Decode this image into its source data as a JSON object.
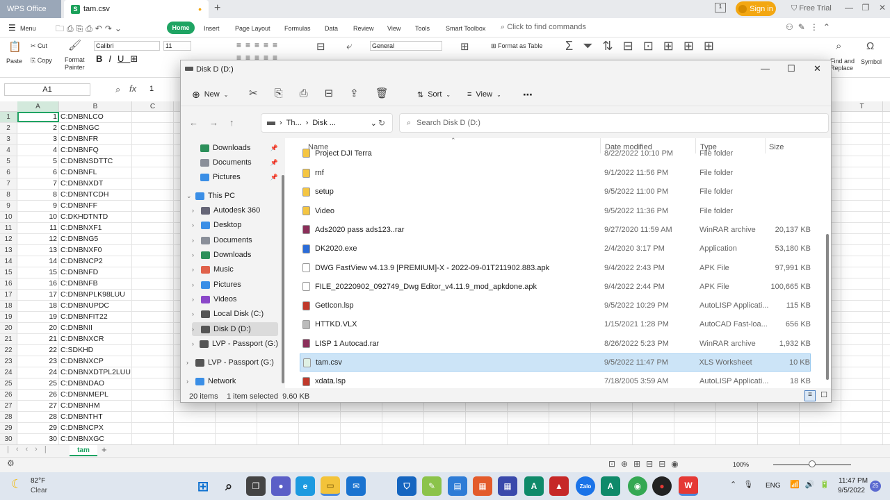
{
  "wps": {
    "tabs": [
      {
        "label": "WPS Office"
      },
      {
        "label": "tam.csv"
      }
    ],
    "csv_badge": "S",
    "sign_in": "Sign in",
    "free_trial": "Free Trial",
    "menu_label": "Menu",
    "ribbon_tabs": [
      "Home",
      "Insert",
      "Page Layout",
      "Formulas",
      "Data",
      "Review",
      "View",
      "Tools",
      "Smart Toolbox"
    ],
    "find_commands": "Click to find commands",
    "toolbar": {
      "paste": "Paste",
      "cut": "Cut",
      "copy": "Copy",
      "format_painter": "Format\nPainter",
      "font": "Calibri",
      "font_size": "11",
      "number_format": "General",
      "format_as_table": "Format as Table",
      "find_replace": "Find and\nReplace",
      "symbol": "Symbol"
    },
    "name_box": "A1",
    "formula_value": "1",
    "columns": [
      "A",
      "B",
      "C",
      "T"
    ],
    "rows": [
      {
        "n": "1",
        "a": "1",
        "b": "C:DNBNLCO"
      },
      {
        "n": "2",
        "a": "2",
        "b": "C:DNBNGC"
      },
      {
        "n": "3",
        "a": "3",
        "b": "C:DNBNFR"
      },
      {
        "n": "4",
        "a": "4",
        "b": "C:DNBNFQ"
      },
      {
        "n": "5",
        "a": "5",
        "b": "C:DNBNSDTTC"
      },
      {
        "n": "6",
        "a": "6",
        "b": "C:DNBNFL"
      },
      {
        "n": "7",
        "a": "7",
        "b": "C:DNBNXDT"
      },
      {
        "n": "8",
        "a": "8",
        "b": "C:DNBNTCDH"
      },
      {
        "n": "9",
        "a": "9",
        "b": "C:DNBNFF"
      },
      {
        "n": "10",
        "a": "10",
        "b": "C:DKHDTNTD"
      },
      {
        "n": "11",
        "a": "11",
        "b": "C:DNBNXF1"
      },
      {
        "n": "12",
        "a": "12",
        "b": "C:DNBNG5"
      },
      {
        "n": "13",
        "a": "13",
        "b": "C:DNBNXF0"
      },
      {
        "n": "14",
        "a": "14",
        "b": "C:DNBNCP2"
      },
      {
        "n": "15",
        "a": "15",
        "b": "C:DNBNFD"
      },
      {
        "n": "16",
        "a": "16",
        "b": "C:DNBNFB"
      },
      {
        "n": "17",
        "a": "17",
        "b": "C:DNBNPLK98LUU"
      },
      {
        "n": "18",
        "a": "18",
        "b": "C:DNBNUPDC"
      },
      {
        "n": "19",
        "a": "19",
        "b": "C:DNBNFIT22"
      },
      {
        "n": "20",
        "a": "20",
        "b": "C:DNBNII"
      },
      {
        "n": "21",
        "a": "21",
        "b": "C:DNBNXCR"
      },
      {
        "n": "22",
        "a": "22",
        "b": "C:SDKHD"
      },
      {
        "n": "23",
        "a": "23",
        "b": "C:DNBNXCP"
      },
      {
        "n": "24",
        "a": "24",
        "b": "C:DNBNXDTPL2LUU"
      },
      {
        "n": "25",
        "a": "25",
        "b": "C:DNBNDAO"
      },
      {
        "n": "26",
        "a": "26",
        "b": "C:DNBNMEPL"
      },
      {
        "n": "27",
        "a": "27",
        "b": "C:DNBNHM"
      },
      {
        "n": "28",
        "a": "28",
        "b": "C:DNBNTHT"
      },
      {
        "n": "29",
        "a": "29",
        "b": "C:DNBNCPX"
      },
      {
        "n": "30",
        "a": "30",
        "b": "C:DNBNXGC"
      }
    ],
    "sheet_tab": "tam",
    "zoom": "100%"
  },
  "explorer": {
    "title": "Disk D (D:)",
    "new_label": "New",
    "sort_label": "Sort",
    "view_label": "View",
    "address": [
      "Th...",
      "Disk ..."
    ],
    "search_placeholder": "Search Disk D (D:)",
    "nav": [
      {
        "label": "Downloads"
      },
      {
        "label": "Documents"
      },
      {
        "label": "Pictures"
      },
      {
        "label": "This PC"
      },
      {
        "label": "Autodesk 360"
      },
      {
        "label": "Desktop"
      },
      {
        "label": "Documents"
      },
      {
        "label": "Downloads"
      },
      {
        "label": "Music"
      },
      {
        "label": "Pictures"
      },
      {
        "label": "Videos"
      },
      {
        "label": "Local Disk (C:)"
      },
      {
        "label": "Disk D (D:)"
      },
      {
        "label": "LVP - Passport (G:)"
      },
      {
        "label": "LVP - Passport (G:)"
      },
      {
        "label": "Network"
      }
    ],
    "headers": {
      "name": "Name",
      "date": "Date modified",
      "type": "Type",
      "size": "Size"
    },
    "files": [
      {
        "name": "Project DJI Terra",
        "date": "8/22/2022 10:10 PM",
        "type": "File folder",
        "size": ""
      },
      {
        "name": "rnf",
        "date": "9/1/2022 11:56 PM",
        "type": "File folder",
        "size": ""
      },
      {
        "name": "setup",
        "date": "9/5/2022 11:00 PM",
        "type": "File folder",
        "size": ""
      },
      {
        "name": "Video",
        "date": "9/5/2022 11:36 PM",
        "type": "File folder",
        "size": ""
      },
      {
        "name": "Ads2020 pass ads123..rar",
        "date": "9/27/2020 11:59 AM",
        "type": "WinRAR archive",
        "size": "20,137 KB"
      },
      {
        "name": "DK2020.exe",
        "date": "2/4/2020 3:17 PM",
        "type": "Application",
        "size": "53,180 KB"
      },
      {
        "name": "DWG FastView v4.13.9 [PREMIUM]-X - 2022-09-01T211902.883.apk",
        "date": "9/4/2022 2:43 PM",
        "type": "APK File",
        "size": "97,991 KB"
      },
      {
        "name": "FILE_20220902_092749_Dwg Editor_v4.11.9_mod_apkdone.apk",
        "date": "9/4/2022 2:44 PM",
        "type": "APK File",
        "size": "100,665 KB"
      },
      {
        "name": "GetIcon.lsp",
        "date": "9/5/2022 10:29 PM",
        "type": "AutoLISP Applicati...",
        "size": "115 KB"
      },
      {
        "name": "HTTKD.VLX",
        "date": "1/15/2021 1:28 PM",
        "type": "AutoCAD Fast-loa...",
        "size": "656 KB"
      },
      {
        "name": "LISP 1 Autocad.rar",
        "date": "8/26/2022 5:23 PM",
        "type": "WinRAR archive",
        "size": "1,932 KB"
      },
      {
        "name": "tam.csv",
        "date": "9/5/2022 11:47 PM",
        "type": "XLS Worksheet",
        "size": "10 KB"
      },
      {
        "name": "xdata.lsp",
        "date": "7/18/2005 3:59 AM",
        "type": "AutoLISP Applicati...",
        "size": "18 KB"
      }
    ],
    "status_items": "20 items",
    "status_selected": "1 item selected  9.60 KB"
  },
  "taskbar": {
    "weather_temp": "82°F",
    "weather_desc": "Clear",
    "lang": "ENG",
    "time": "11:47 PM",
    "date": "9/5/2022",
    "notif_count": "25"
  },
  "colors": {
    "wps_green": "#1fa463",
    "selection_blue": "#cce4f7",
    "signin_orange": "#f3a712"
  }
}
